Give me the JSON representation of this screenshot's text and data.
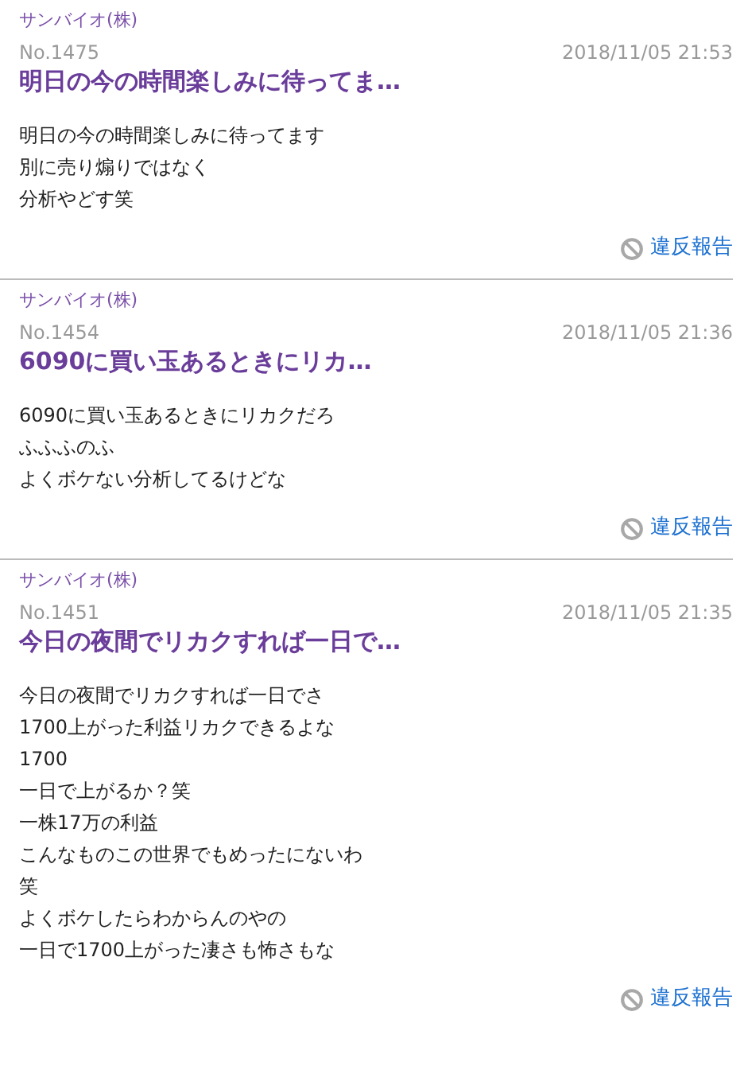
{
  "posts": [
    {
      "author": "サンバイオ(株)",
      "number": "No.1475",
      "datetime": "2018/11/05 21:53",
      "title": "明日の今の時間楽しみに待ってま…",
      "body": [
        "明日の今の時間楽しみに待ってます",
        "別に売り煽りではなく",
        "分析やどす笑"
      ],
      "report": "違反報告"
    },
    {
      "author": "サンバイオ(株)",
      "number": "No.1454",
      "datetime": "2018/11/05 21:36",
      "title": "6090に買い玉あるときにリカ…",
      "body": [
        "6090に買い玉あるときにリカクだろ",
        "ふふふのふ",
        "よくボケない分析してるけどな"
      ],
      "report": "違反報告"
    },
    {
      "author": "サンバイオ(株)",
      "number": "No.1451",
      "datetime": "2018/11/05 21:35",
      "title": "今日の夜間でリカクすれば一日で…",
      "body": [
        "今日の夜間でリカクすれば一日でさ",
        "1700上がった利益リカクできるよな",
        "1700",
        "一日で上がるか？笑",
        "一株17万の利益",
        "こんなものこの世界でもめったにないわ",
        "笑",
        "よくボケしたらわからんのやの",
        "一日で1700上がった凄さも怖さもな"
      ],
      "report": "違反報告"
    }
  ]
}
